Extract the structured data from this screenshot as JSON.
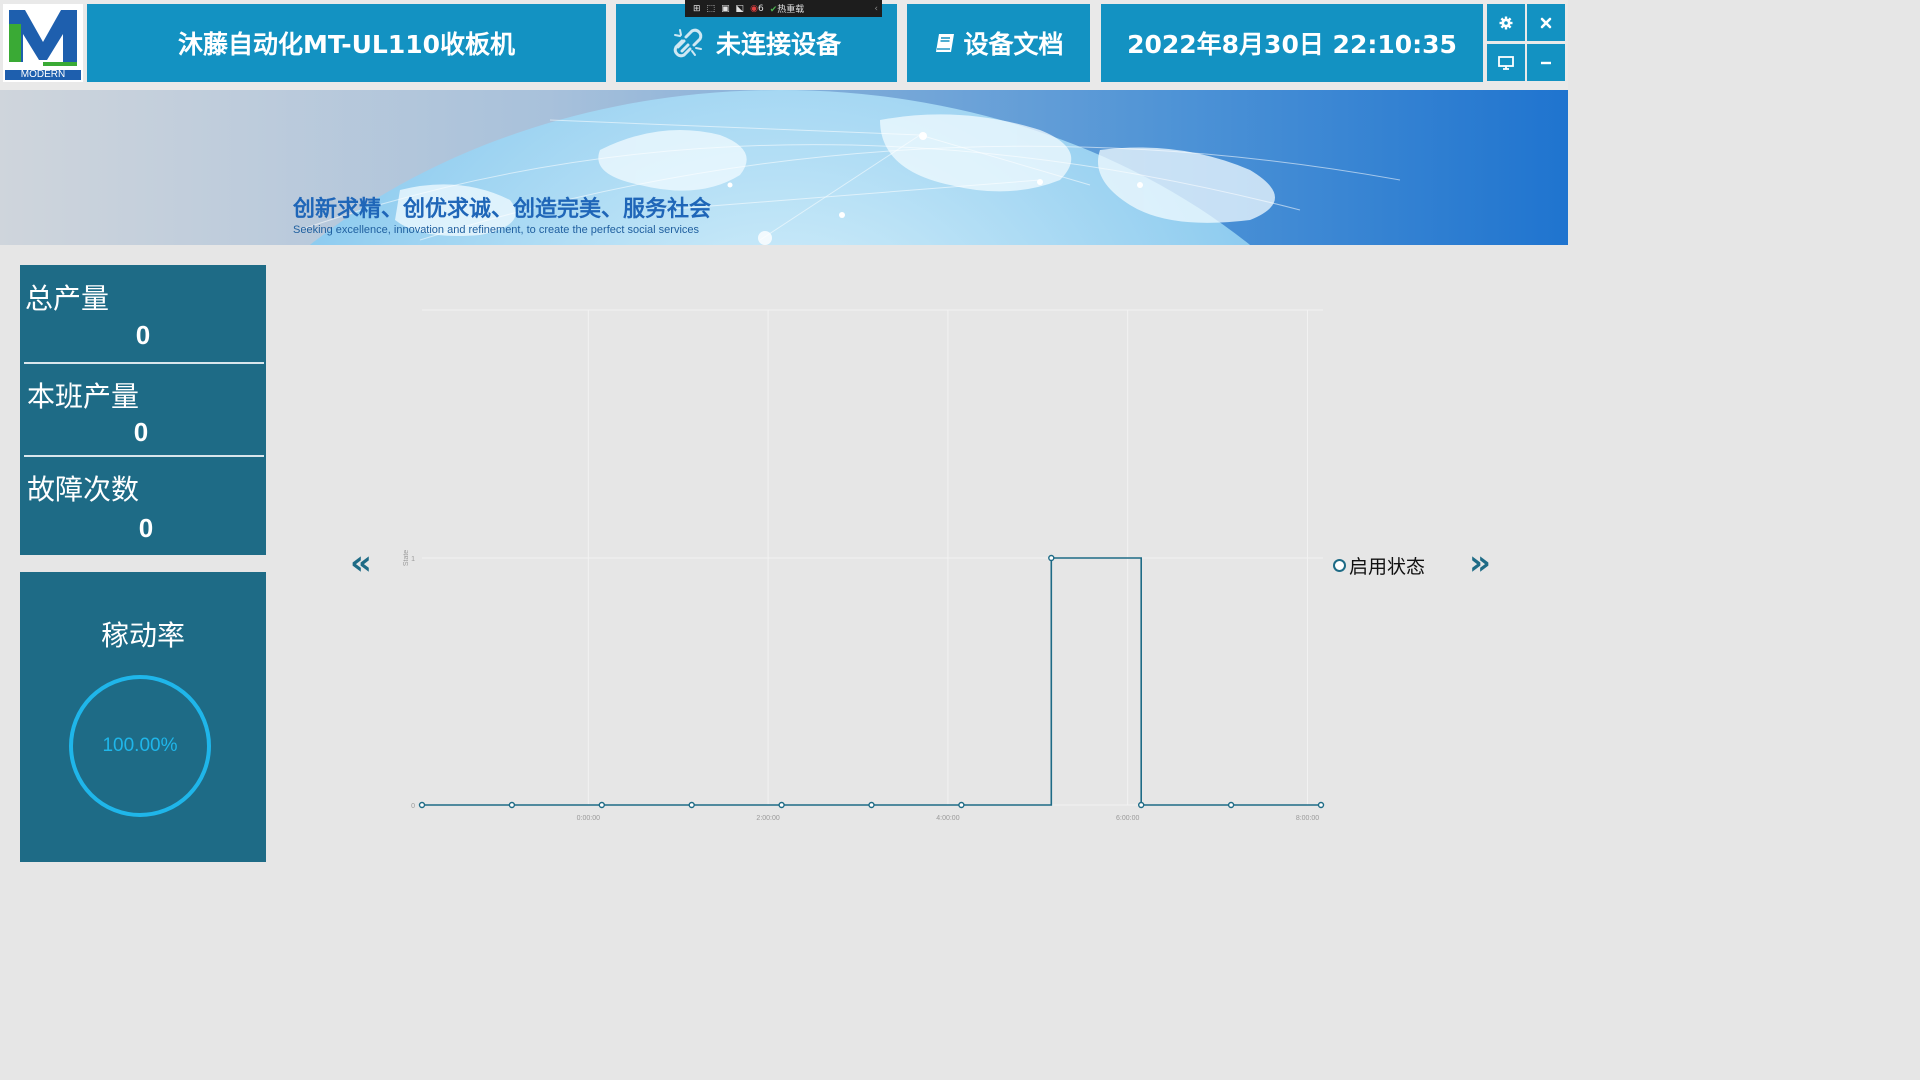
{
  "header": {
    "logo_text": "MODERN",
    "title": "沐藤自动化MT-UL110收板机",
    "connection_status": "未连接设备",
    "docs_label": "设备文档",
    "datetime": "2022年8月30日 22:10:35"
  },
  "debug_toolbar": {
    "binding_count": "6",
    "hot_reload_label": "热重载"
  },
  "banner": {
    "slogan_cn": "创新求精、创优求诚、创造完美、服务社会",
    "slogan_en": "Seeking excellence, innovation and refinement, to create the perfect social services"
  },
  "stats": {
    "total_output_label": "总产量",
    "total_output_value": "0",
    "shift_output_label": "本班产量",
    "shift_output_value": "0",
    "fault_count_label": "故障次数",
    "fault_count_value": "0"
  },
  "uptime": {
    "label": "稼动率",
    "value": "100.00%"
  },
  "nav": {
    "prev": "«",
    "next": "»"
  },
  "colors": {
    "accent": "#1392c2",
    "panel": "#1e6b86",
    "ring": "#1fb6ea",
    "background": "#e6e6e6"
  },
  "icons": [
    "settings-gear-icon",
    "close-icon",
    "monitor-icon",
    "minimize-icon",
    "link-broken-icon",
    "book-icon"
  ],
  "chart_data": {
    "type": "line",
    "step": true,
    "ylabel": "State",
    "xlabel": "",
    "ylim": [
      0,
      1
    ],
    "yticks": [
      0,
      1
    ],
    "xticks": [
      "0:00:00",
      "2:00:00",
      "4:00:00",
      "6:00:00",
      "8:00:00"
    ],
    "xlim_hours": [
      -1.85,
      8.15
    ],
    "series": [
      {
        "name": "启用状态",
        "color": "#1e6b86",
        "x_hours": [
          -1.85,
          -0.85,
          0.15,
          1.15,
          2.15,
          3.15,
          4.15,
          5.15,
          6.15,
          7.15,
          8.15
        ],
        "values": [
          0,
          0,
          0,
          0,
          0,
          0,
          0,
          1,
          0,
          0,
          0
        ]
      }
    ]
  }
}
